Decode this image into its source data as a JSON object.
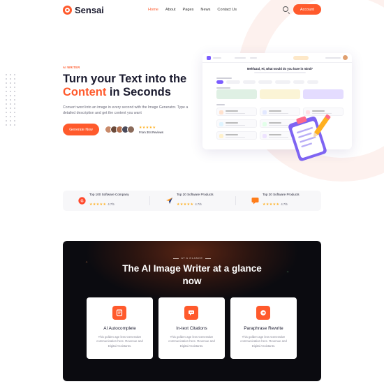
{
  "brand": {
    "name": "Sensai",
    "accent": "#ff5a2c"
  },
  "nav": {
    "items": [
      "Home",
      "About",
      "Pages",
      "News",
      "Contact Us"
    ],
    "active": "Home",
    "account_label": "Account"
  },
  "hero": {
    "eyebrow": "AI WRITER",
    "title_line1": "Turn your Text into the",
    "title_accent": "Content",
    "title_rest": " in Seconds",
    "description": "Convert word into an image in every second with the Image Generator. Type a detailed description and get the content you want",
    "cta_label": "Generate Now",
    "stars": "★★★★★",
    "reviews": "From 304 Reviews"
  },
  "dashboard": {
    "question": "Mehfuzul, Hi, what would do you have in mind?"
  },
  "stats": [
    {
      "title": "Top 100 Software Company",
      "stars": "★★★★★",
      "score": "4.7/5",
      "icon": "g2-badge-icon"
    },
    {
      "title": "Top 20 Software Products",
      "stars": "★★★★★",
      "score": "4.7/5",
      "icon": "capterra-arrow-icon"
    },
    {
      "title": "Top 20 Software Products",
      "stars": "★★★★★",
      "score": "4.7/5",
      "icon": "chat-bubble-icon"
    }
  ],
  "glance": {
    "eyebrow": "AT A GLANCE",
    "title": "The AI Image Writer at a glance now",
    "features": [
      {
        "title": "AI Autocomplete",
        "description": "This golden age less Generative communication here. Revenue and Digital Assistants.",
        "icon": "autocomplete-icon"
      },
      {
        "title": "In-text Citations",
        "description": "This golden age less Generative communication here. Revenue and Digital Assistants.",
        "icon": "citation-chat-icon"
      },
      {
        "title": "Paraphrase Rewrite",
        "description": "This golden age less Generative communication here. Revenue and Digital Assistants.",
        "icon": "rewrite-icon"
      }
    ]
  }
}
